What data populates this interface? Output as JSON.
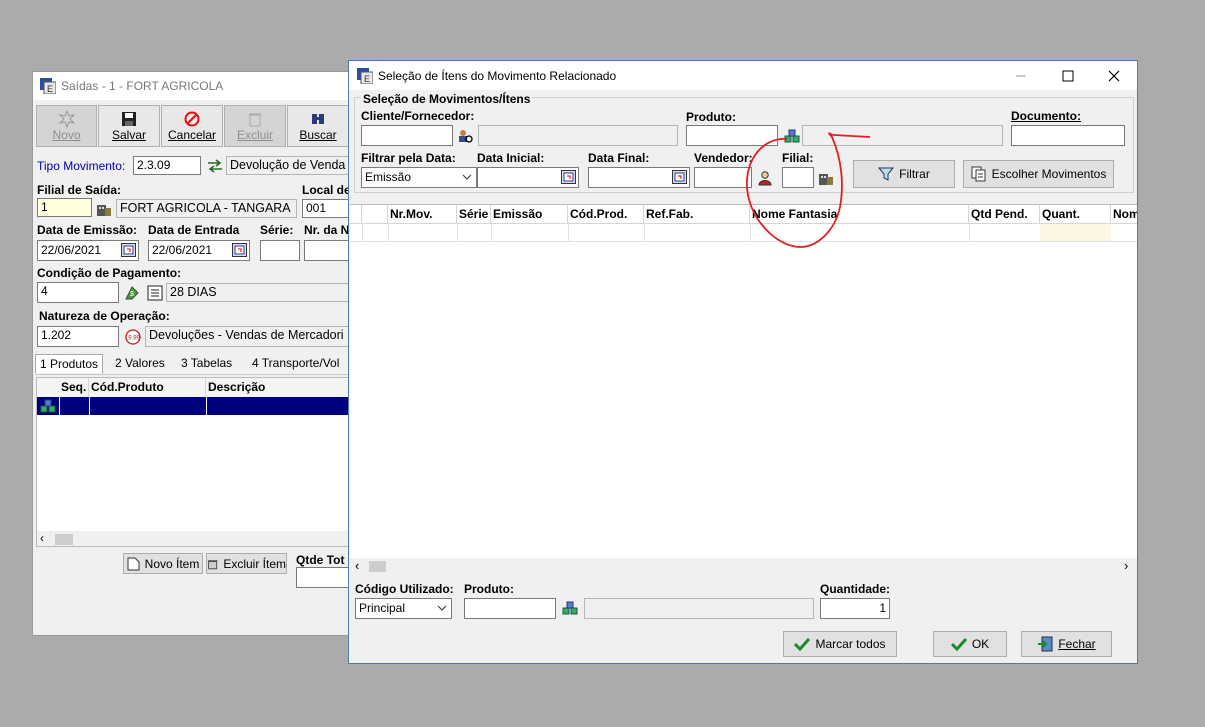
{
  "back_window": {
    "title": "Saídas - 1 - FORT AGRICOLA",
    "toolbar": {
      "novo": "Novo",
      "salvar": "Salvar",
      "cancelar": "Cancelar",
      "excluir": "Excluir",
      "buscar": "Buscar"
    },
    "tipo_movimento_label": "Tipo Movimento:",
    "tipo_movimento_value": "2.3.09",
    "tipo_movimento_desc": "Devolução de Venda",
    "filial_saida_label": "Filial de Saída:",
    "filial_saida_value": "1",
    "filial_saida_desc": "FORT AGRICOLA - TANGARA",
    "local_label": "Local de",
    "local_value": "001",
    "data_emissao_label": "Data de Emissão:",
    "data_emissao_value": "22/06/2021",
    "data_entrada_label": "Data de Entrada",
    "data_entrada_value": "22/06/2021",
    "serie_label": "Série:",
    "nr_label": "Nr. da N",
    "cond_pagamento_label": "Condição de Pagamento:",
    "cond_pagamento_value": "4",
    "cond_pagamento_desc": "28 DIAS",
    "natureza_label": "Natureza de Operação:",
    "natureza_value": "1.202",
    "natureza_desc": "Devoluções - Vendas de Mercadori",
    "tabs": [
      "1 Produtos",
      "2 Valores",
      "3 Tabelas",
      "4 Transporte/Vol"
    ],
    "grid_headers": [
      "Seq.",
      "Cód.Produto",
      "Descrição"
    ],
    "novo_item": "Novo Ítem",
    "excluir_item": "Excluir Ítem",
    "qtde_total_label": "Qtde Tot"
  },
  "dialog": {
    "title": "Seleção de Ítens do Movimento Relacionado",
    "group_title": "Seleção de Movimentos/Ítens",
    "cliente_label": "Cliente/Fornecedor:",
    "produto_label": "Produto:",
    "documento_label": "Documento:",
    "filtrar_data_label": "Filtrar pela Data:",
    "filtrar_data_value": "Emissão",
    "data_inicial_label": "Data Inicial:",
    "data_final_label": "Data Final:",
    "vendedor_label": "Vendedor:",
    "filial_label": "Filial:",
    "filtrar_button": "Filtrar",
    "escolher_button": "Escolher Movimentos",
    "grid_headers": [
      "Nr.Mov.",
      "Série",
      "Emissão",
      "Cód.Prod.",
      "Ref.Fab.",
      "Nome Fantasia",
      "Qtd Pend.",
      "Quant.",
      "Nom"
    ],
    "codigo_utilizado_label": "Código Utilizado:",
    "codigo_utilizado_value": "Principal",
    "produto_bottom_label": "Produto:",
    "quantidade_label": "Quantidade:",
    "quantidade_value": "1",
    "marcar_todos": "Marcar todos",
    "ok": "OK",
    "fechar": "Fechar"
  },
  "colors": {
    "accent": "#0000aa",
    "selected_row": "#000080",
    "annotation": "#e02020"
  }
}
